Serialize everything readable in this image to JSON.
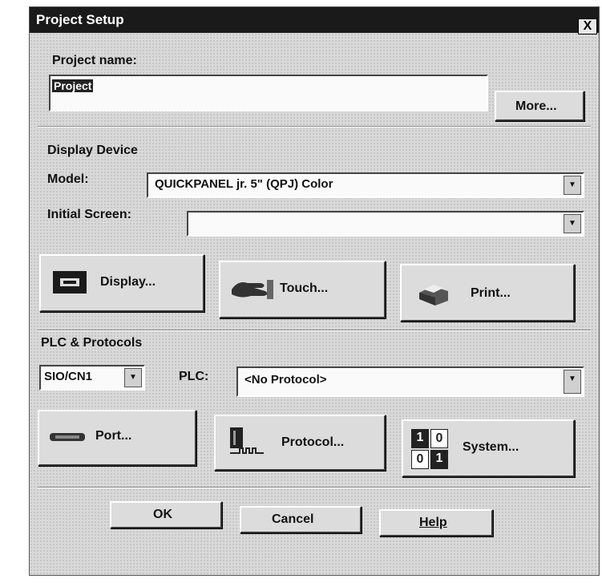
{
  "window": {
    "title": "Project Setup",
    "close_glyph": "X"
  },
  "project": {
    "label": "Project name:",
    "value": "Project",
    "more_button": "More..."
  },
  "display_device": {
    "heading": "Display Device",
    "model_label": "Model:",
    "model_value": "QUICKPANEL jr. 5\" (QPJ) Color",
    "initial_screen_label": "Initial Screen:",
    "initial_screen_value": "",
    "buttons": {
      "display": "Display...",
      "touch": "Touch...",
      "print": "Print..."
    }
  },
  "plc": {
    "heading": "PLC & Protocols",
    "port_value": "SIO/CN1",
    "plc_label": "PLC:",
    "plc_value": "<No Protocol>",
    "buttons": {
      "port": "Port...",
      "protocol": "Protocol...",
      "system": "System..."
    },
    "system_icon_digits": [
      "1",
      "0",
      "0",
      "1"
    ]
  },
  "footer": {
    "ok": "OK",
    "cancel": "Cancel",
    "help": "Help"
  },
  "icons": {
    "display": "monitor-icon",
    "touch": "hand-touch-icon",
    "print": "printer-icon",
    "port": "serial-port-icon",
    "protocol": "waveform-icon",
    "system": "binary-grid-icon"
  }
}
